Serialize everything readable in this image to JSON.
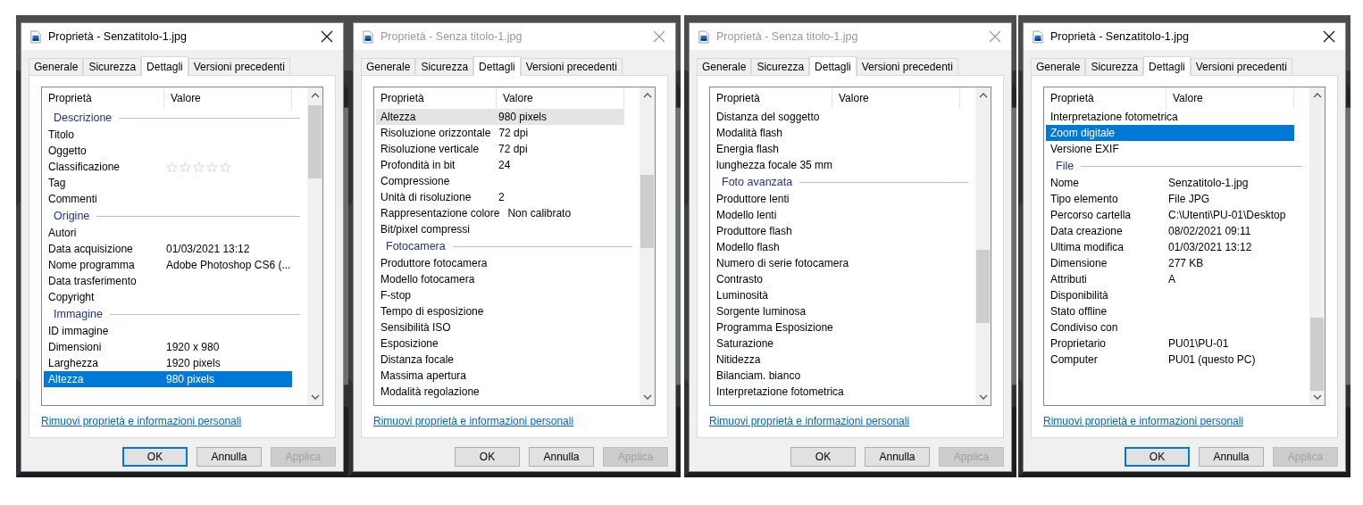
{
  "dialogs": [
    {
      "title": "Proprietà - Senzatitolo-1.jpg",
      "active": true,
      "tabs": [
        {
          "label": "Generale",
          "selected": false
        },
        {
          "label": "Sicurezza",
          "selected": false
        },
        {
          "label": "Dettagli",
          "selected": true
        },
        {
          "label": "Versioni precedenti",
          "selected": false
        }
      ],
      "columns": [
        "Proprietà",
        "Valore"
      ],
      "groups": [
        {
          "heading": "Descrizione",
          "rows": [
            {
              "name": "Titolo",
              "selected": false,
              "hovered": false
            },
            {
              "name": "Oggetto",
              "selected": false,
              "hovered": false
            },
            {
              "name": "Classificazione",
              "stars": 0,
              "selected": false,
              "hovered": false
            },
            {
              "name": "Tag",
              "selected": false,
              "hovered": false
            },
            {
              "name": "Commenti",
              "selected": false,
              "hovered": false
            }
          ]
        },
        {
          "heading": "Origine",
          "rows": [
            {
              "name": "Autori",
              "selected": false,
              "hovered": false
            },
            {
              "name": "Data acquisizione",
              "value": "01/03/2021 13:12",
              "selected": false,
              "hovered": false
            },
            {
              "name": "Nome programma",
              "value": "Adobe Photoshop CS6 (...",
              "selected": false,
              "hovered": false
            },
            {
              "name": "Data trasferimento",
              "selected": false,
              "hovered": false
            },
            {
              "name": "Copyright",
              "selected": false,
              "hovered": false
            }
          ]
        },
        {
          "heading": "Immagine",
          "rows": [
            {
              "name": "ID immagine",
              "selected": false,
              "hovered": false
            },
            {
              "name": "Dimensioni",
              "value": "1920 x 980",
              "selected": false,
              "hovered": false
            },
            {
              "name": "Larghezza",
              "value": "1920 pixels",
              "selected": false,
              "hovered": false
            },
            {
              "name": "Altezza",
              "value": "980 pixels",
              "selected": true,
              "hovered": false
            }
          ]
        }
      ],
      "link": "Rimuovi proprietà e informazioni personali",
      "buttons": [
        {
          "label": "OK",
          "focused": true,
          "disabled": false
        },
        {
          "label": "Annulla",
          "focused": false,
          "disabled": false
        },
        {
          "label": "Applica",
          "focused": false,
          "disabled": true
        }
      ]
    },
    {
      "title": "Proprietà - Senza titolo-1.jpg",
      "active": false,
      "tabs": [
        {
          "label": "Generale",
          "selected": false
        },
        {
          "label": "Sicurezza",
          "selected": false
        },
        {
          "label": "Dettagli",
          "selected": true
        },
        {
          "label": "Versioni precedenti",
          "selected": false
        }
      ],
      "columns": [
        "Proprietà",
        "Valore"
      ],
      "groups": [
        {
          "rows": [
            {
              "name": "Altezza",
              "value": "980 pixels",
              "selected": false,
              "hovered": true
            },
            {
              "name": "Risoluzione orizzontale",
              "value": "72 dpi",
              "selected": false,
              "hovered": false
            },
            {
              "name": "Risoluzione verticale",
              "value": "72 dpi",
              "selected": false,
              "hovered": false
            },
            {
              "name": "Profondità in bit",
              "value": "24",
              "selected": false,
              "hovered": false
            },
            {
              "name": "Compressione",
              "selected": false,
              "hovered": false
            },
            {
              "name": "Unità di risoluzione",
              "value": "2",
              "selected": false,
              "hovered": false
            },
            {
              "name": "Rappresentazione colore",
              "value": "Non calibrato",
              "selected": false,
              "hovered": false
            },
            {
              "name": "Bit/pixel compressi",
              "selected": false,
              "hovered": false
            }
          ]
        },
        {
          "heading": "Fotocamera",
          "rows": [
            {
              "name": "Produttore fotocamera",
              "selected": false,
              "hovered": false
            },
            {
              "name": "Modello fotocamera",
              "selected": false,
              "hovered": false
            },
            {
              "name": "F-stop",
              "selected": false,
              "hovered": false
            },
            {
              "name": "Tempo di esposizione",
              "selected": false,
              "hovered": false
            },
            {
              "name": "Sensibilità ISO",
              "selected": false,
              "hovered": false
            },
            {
              "name": "Esposizione",
              "selected": false,
              "hovered": false
            },
            {
              "name": "Distanza focale",
              "selected": false,
              "hovered": false
            },
            {
              "name": "Massima apertura",
              "selected": false,
              "hovered": false
            },
            {
              "name": "Modalità regolazione",
              "selected": false,
              "hovered": false
            }
          ]
        }
      ],
      "link": "Rimuovi proprietà e informazioni personali",
      "buttons": [
        {
          "label": "OK",
          "focused": false,
          "disabled": false
        },
        {
          "label": "Annulla",
          "focused": false,
          "disabled": false
        },
        {
          "label": "Applica",
          "focused": false,
          "disabled": true
        }
      ]
    },
    {
      "title": "Proprietà - Senza titolo-1.jpg",
      "active": false,
      "tabs": [
        {
          "label": "Generale",
          "selected": false
        },
        {
          "label": "Sicurezza",
          "selected": false
        },
        {
          "label": "Dettagli",
          "selected": true
        },
        {
          "label": "Versioni precedenti",
          "selected": false
        }
      ],
      "columns": [
        "Proprietà",
        "Valore"
      ],
      "groups": [
        {
          "rows": [
            {
              "name": "Distanza del soggetto",
              "selected": false,
              "hovered": false
            },
            {
              "name": "Modalità flash",
              "selected": false,
              "hovered": false
            },
            {
              "name": "Energia flash",
              "selected": false,
              "hovered": false
            },
            {
              "name": "lunghezza focale 35 mm",
              "selected": false,
              "hovered": false
            }
          ]
        },
        {
          "heading": "Foto avanzata",
          "rows": [
            {
              "name": "Produttore lenti",
              "selected": false,
              "hovered": false
            },
            {
              "name": "Modello lenti",
              "selected": false,
              "hovered": false
            },
            {
              "name": "Produttore flash",
              "selected": false,
              "hovered": false
            },
            {
              "name": "Modello flash",
              "selected": false,
              "hovered": false
            },
            {
              "name": "Numero di serie fotocamera",
              "selected": false,
              "hovered": false
            },
            {
              "name": "Contrasto",
              "selected": false,
              "hovered": false
            },
            {
              "name": "Luminosità",
              "selected": false,
              "hovered": false
            },
            {
              "name": "Sorgente luminosa",
              "selected": false,
              "hovered": false
            },
            {
              "name": "Programma Esposizione",
              "selected": false,
              "hovered": false
            },
            {
              "name": "Saturazione",
              "selected": false,
              "hovered": false
            },
            {
              "name": "Nitidezza",
              "selected": false,
              "hovered": false
            },
            {
              "name": "Bilanciam. bianco",
              "selected": false,
              "hovered": false
            },
            {
              "name": "Interpretazione fotometrica",
              "selected": false,
              "hovered": false
            }
          ]
        }
      ],
      "link": "Rimuovi proprietà e informazioni personali",
      "buttons": [
        {
          "label": "OK",
          "focused": false,
          "disabled": false
        },
        {
          "label": "Annulla",
          "focused": false,
          "disabled": false
        },
        {
          "label": "Applica",
          "focused": false,
          "disabled": true
        }
      ]
    },
    {
      "title": "Proprietà - Senzatitolo-1.jpg",
      "active": true,
      "tabs": [
        {
          "label": "Generale",
          "selected": false
        },
        {
          "label": "Sicurezza",
          "selected": false
        },
        {
          "label": "Dettagli",
          "selected": true
        },
        {
          "label": "Versioni precedenti",
          "selected": false
        }
      ],
      "columns": [
        "Proprietà",
        "Valore"
      ],
      "groups": [
        {
          "rows": [
            {
              "name": "Interpretazione fotometrica",
              "selected": false,
              "hovered": false
            },
            {
              "name": "Zoom digitale",
              "selected": true,
              "hovered": false
            },
            {
              "name": "Versione EXIF",
              "selected": false,
              "hovered": false
            }
          ]
        },
        {
          "heading": "File",
          "rows": [
            {
              "name": "Nome",
              "value": "Senzatitolo-1.jpg",
              "selected": false,
              "hovered": false
            },
            {
              "name": "Tipo elemento",
              "value": "File JPG",
              "selected": false,
              "hovered": false
            },
            {
              "name": "Percorso cartella",
              "value": "C:\\Utenti\\PU-01\\Desktop",
              "selected": false,
              "hovered": false
            },
            {
              "name": "Data creazione",
              "value": "08/02/2021 09:11",
              "selected": false,
              "hovered": false
            },
            {
              "name": "Ultima modifica",
              "value": "01/03/2021 13:12",
              "selected": false,
              "hovered": false
            },
            {
              "name": "Dimensione",
              "value": "277 KB",
              "selected": false,
              "hovered": false
            },
            {
              "name": "Attributi",
              "value": "A",
              "selected": false,
              "hovered": false
            },
            {
              "name": "Disponibilità",
              "selected": false,
              "hovered": false
            },
            {
              "name": "Stato offline",
              "selected": false,
              "hovered": false
            },
            {
              "name": "Condiviso con",
              "selected": false,
              "hovered": false
            },
            {
              "name": "Proprietario",
              "value": "PU01\\PU-01",
              "selected": false,
              "hovered": false
            },
            {
              "name": "Computer",
              "value": "PU01 (questo PC)",
              "selected": false,
              "hovered": false
            }
          ]
        }
      ],
      "link": "Rimuovi proprietà e informazioni personali",
      "buttons": [
        {
          "label": "OK",
          "focused": true,
          "disabled": false
        },
        {
          "label": "Annulla",
          "focused": false,
          "disabled": false
        },
        {
          "label": "Applica",
          "focused": false,
          "disabled": true
        }
      ]
    }
  ]
}
